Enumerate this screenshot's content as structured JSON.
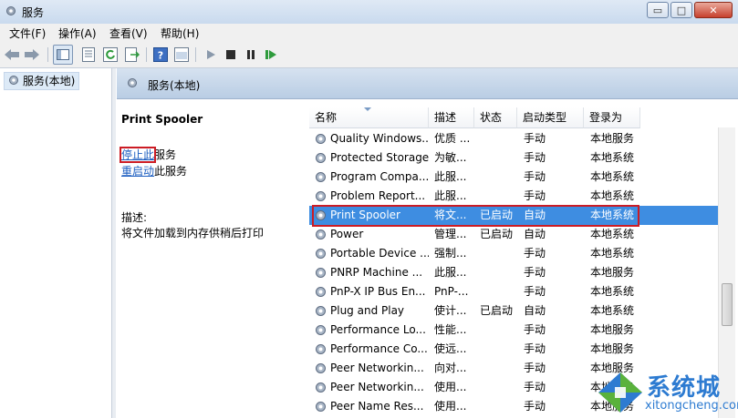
{
  "window": {
    "title": "服务",
    "buttons": {
      "minimize": "▭",
      "maximize": "□",
      "close": "✕"
    }
  },
  "menu": [
    "文件(F)",
    "操作(A)",
    "查看(V)",
    "帮助(H)"
  ],
  "tree": {
    "node": "服务(本地)"
  },
  "header": {
    "title": "服务(本地)"
  },
  "detail": {
    "service_name": "Print Spooler",
    "stop_link": "停止此",
    "stop_suffix": "服务",
    "restart_link": "重启动",
    "restart_suffix": "此服务",
    "desc_label": "描述:",
    "desc_text": "将文件加载到内存供稍后打印"
  },
  "columns": [
    "名称",
    "描述",
    "状态",
    "启动类型",
    "登录为"
  ],
  "rows": [
    {
      "name": "Quality Windows...",
      "desc": "优质 ...",
      "status": "",
      "startup": "手动",
      "logon": "本地服务"
    },
    {
      "name": "Protected Storage",
      "desc": "为敏...",
      "status": "",
      "startup": "手动",
      "logon": "本地系统"
    },
    {
      "name": "Program Compa...",
      "desc": "此服...",
      "status": "",
      "startup": "手动",
      "logon": "本地系统"
    },
    {
      "name": "Problem Report...",
      "desc": "此服...",
      "status": "",
      "startup": "手动",
      "logon": "本地系统"
    },
    {
      "name": "Print Spooler",
      "desc": "将文...",
      "status": "已启动",
      "startup": "自动",
      "logon": "本地系统"
    },
    {
      "name": "Power",
      "desc": "管理...",
      "status": "已启动",
      "startup": "自动",
      "logon": "本地系统"
    },
    {
      "name": "Portable Device ...",
      "desc": "强制...",
      "status": "",
      "startup": "手动",
      "logon": "本地系统"
    },
    {
      "name": "PNRP Machine ...",
      "desc": "此服...",
      "status": "",
      "startup": "手动",
      "logon": "本地服务"
    },
    {
      "name": "PnP-X IP Bus En...",
      "desc": "PnP-...",
      "status": "",
      "startup": "手动",
      "logon": "本地系统"
    },
    {
      "name": "Plug and Play",
      "desc": "使计...",
      "status": "已启动",
      "startup": "自动",
      "logon": "本地系统"
    },
    {
      "name": "Performance Lo...",
      "desc": "性能...",
      "status": "",
      "startup": "手动",
      "logon": "本地服务"
    },
    {
      "name": "Performance Co...",
      "desc": "使远...",
      "status": "",
      "startup": "手动",
      "logon": "本地服务"
    },
    {
      "name": "Peer Networkin...",
      "desc": "向对...",
      "status": "",
      "startup": "手动",
      "logon": "本地服务"
    },
    {
      "name": "Peer Networkin...",
      "desc": "使用...",
      "status": "",
      "startup": "手动",
      "logon": "本地服务"
    },
    {
      "name": "Peer Name Res...",
      "desc": "使用...",
      "status": "",
      "startup": "手动",
      "logon": "本地服务"
    }
  ],
  "selected_row": 4,
  "watermark": {
    "brand": "系统城",
    "domain": "xitongcheng.com"
  },
  "colors": {
    "selection": "#3e8de1",
    "highlight_box": "#cc1c24",
    "link": "#1c5ec0"
  }
}
